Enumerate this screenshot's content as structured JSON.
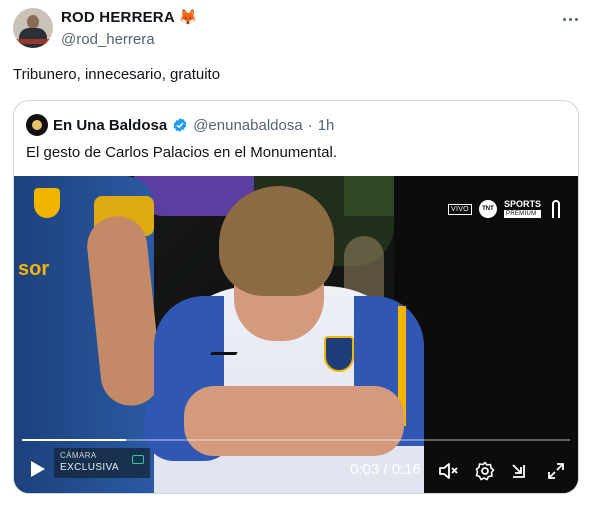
{
  "author": {
    "display_name": "ROD HERRERA",
    "emoji": "🦊",
    "handle": "@rod_herrera"
  },
  "tweet": {
    "text": "Tribunero, innecesario, gratuito"
  },
  "quote": {
    "display_name": "En Una Baldosa",
    "handle": "@enunabaldosa",
    "separator": "·",
    "time": "1h",
    "text": "El gesto de Carlos Palacios en el Monumental."
  },
  "video": {
    "current_time": "0:03",
    "duration": "0:16",
    "time_display": "0:03 / 0:16",
    "progress_fraction": 0.19,
    "badge_line1": "CÁMARA",
    "badge_line2": "EXCLUSIVA",
    "watermark_box": "VIVO",
    "watermark_brand": "TNT",
    "watermark_sports": "SPORTS",
    "watermark_premium": "PREMIUM",
    "sponsor_text": "sor"
  },
  "icons": {
    "more": "more-icon",
    "verified": "verified-badge-icon",
    "play": "play-icon",
    "mute": "mute-icon",
    "settings": "settings-icon",
    "popout": "popout-icon",
    "fullscreen": "fullscreen-icon"
  },
  "colors": {
    "text_primary": "#0f1419",
    "text_secondary": "#536471",
    "border": "#cfd9de",
    "verified": "#1d9bf0"
  }
}
